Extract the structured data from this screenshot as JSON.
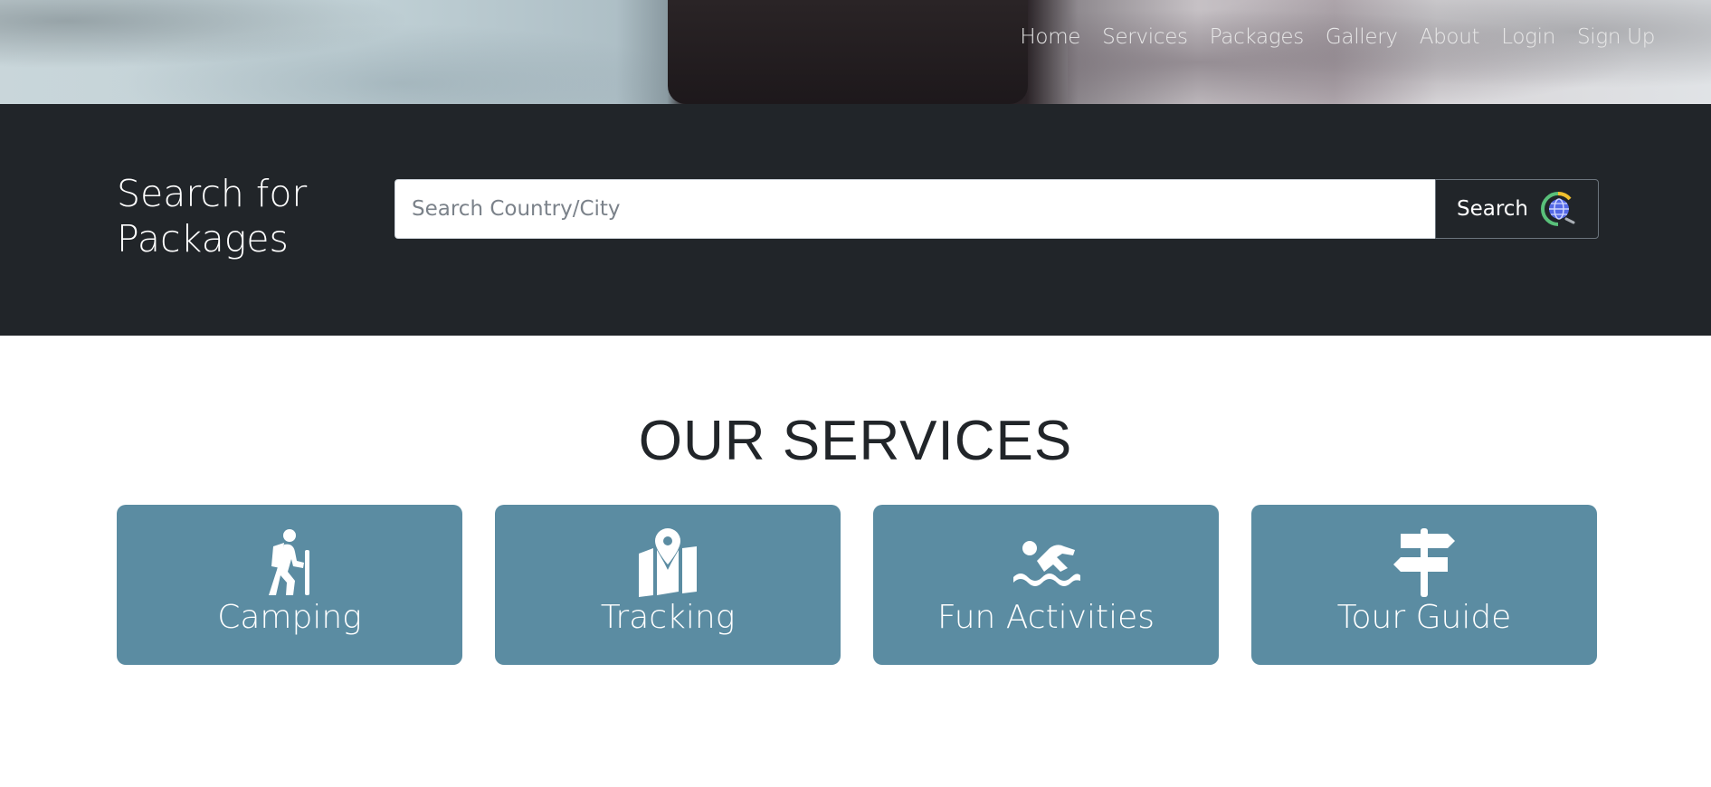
{
  "nav": {
    "items": [
      {
        "label": "Home"
      },
      {
        "label": "Services"
      },
      {
        "label": "Packages"
      },
      {
        "label": "Gallery"
      },
      {
        "label": "About"
      },
      {
        "label": "Login"
      },
      {
        "label": "Sign Up"
      }
    ]
  },
  "search": {
    "title": "Search for Packages",
    "placeholder": "Search Country/City",
    "value": "",
    "button_label": "Search",
    "button_icon": "globe-search-icon"
  },
  "services": {
    "title": "OUR SERVICES",
    "cards": [
      {
        "label": "Camping",
        "icon": "hiking-icon"
      },
      {
        "label": "Tracking",
        "icon": "map-location-icon"
      },
      {
        "label": "Fun Activities",
        "icon": "swimmer-icon"
      },
      {
        "label": "Tour Guide",
        "icon": "signpost-icon"
      }
    ],
    "card_color": "#5b8ca2"
  },
  "colors": {
    "search_band": "#212529",
    "text_dark": "#212529"
  }
}
